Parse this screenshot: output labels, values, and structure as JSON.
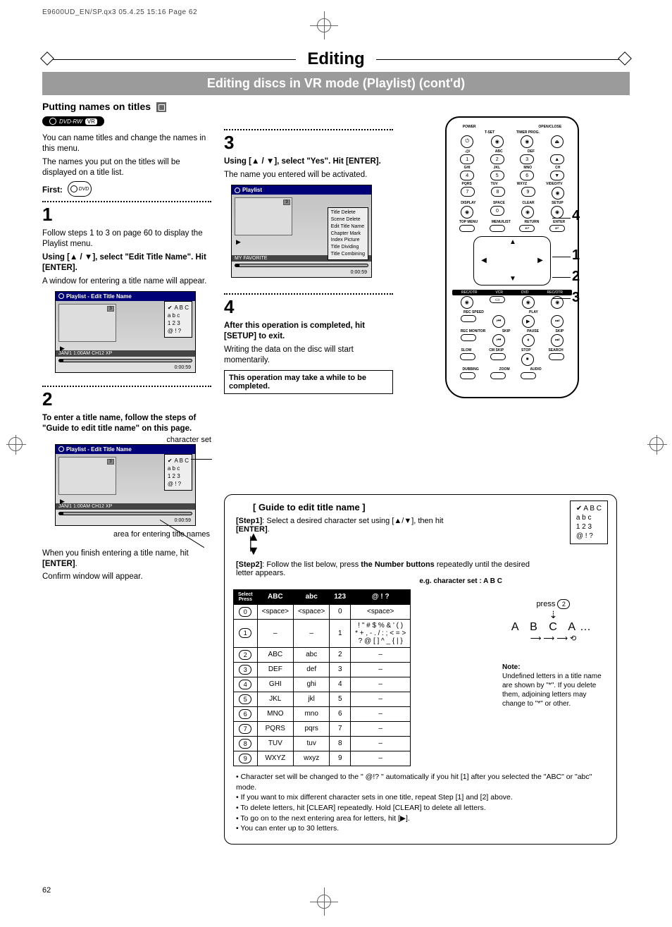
{
  "pageinfo": "E9600UD_EN/SP.qx3  05.4.25 15:16  Page 62",
  "title": "Editing",
  "subtitle": "Editing discs in VR mode (Playlist) (cont'd)",
  "section": "Putting names on titles",
  "dvdrw_badge": {
    "text": "DVD-RW",
    "corner": "VR"
  },
  "intro_p1": "You can name titles and change the names in this menu.",
  "intro_p2": "The names you put on the titles will be displayed on a title list.",
  "first_label": "First:",
  "first_icon_text": "DVD",
  "step1_num": "1",
  "step1_p1": "Follow steps 1 to 3 on page 60 to display the Playlist menu.",
  "step1_bold": "Using [▲ / ▼], select \"Edit Title Name\". Hit [ENTER].",
  "step1_p2": "A window for entering a title name will appear.",
  "osd1": {
    "header": "Playlist - Edit Title Name",
    "thumb_badge": "3",
    "charset": [
      "A B C",
      "a b c",
      "1 2 3",
      "@ ! ?"
    ],
    "footer_left": "JAN/1 1:00AM CH12 XP",
    "footer_right": "0:00:59"
  },
  "step2_num": "2",
  "step2_bold": "To enter a title name, follow the steps of \"Guide to edit title name\" on this page.",
  "step2_lbl_charset": "character set",
  "step2_lbl_area": "area for entering title names",
  "step2_p1": "When you finish entering a title name, hit ",
  "step2_enter": "[ENTER]",
  "step2_p2": "Confirm window will appear.",
  "step3_num": "3",
  "step3_bold": "Using [▲ / ▼], select \"Yes\". Hit [ENTER].",
  "step3_p1": "The name you entered will be activated.",
  "osd3": {
    "header": "Playlist",
    "thumb_badge": "3",
    "menu": [
      "Title Delete",
      "Scene Delete",
      "Edit Title Name",
      "Chapter Mark",
      "Index Picture",
      "Title Dividing",
      "Title Combining"
    ],
    "footer_left": "MY FAVORITE",
    "footer_right": "0:00:59"
  },
  "step4_num": "4",
  "step4_bold": "After this operation is completed, hit [SETUP] to exit.",
  "step4_p1": "Writing the data on the disc will start momentarily.",
  "step4_note": "This operation may take a while to be completed.",
  "remote_labels": {
    "r1": [
      "POWER",
      "",
      "",
      "OPEN/CLOSE"
    ],
    "r2": [
      "",
      "T-SET",
      "TIMER PROG.",
      ""
    ],
    "r3": [
      ".@/",
      "ABC",
      "DEF",
      ""
    ],
    "r4": [
      "GHI",
      "JKL",
      "MNO",
      "CH"
    ],
    "r5": [
      "PQRS",
      "TUV",
      "WXYZ",
      "VIDEO/TV"
    ],
    "r6": [
      "DISPLAY",
      "SPACE",
      "CLEAR",
      "SETUP"
    ],
    "r7": [
      "TOP MENU",
      "MENU/LIST",
      "RETURN",
      "ENTER"
    ],
    "bar1": [
      "REC/OTR",
      "VCR",
      "DVD",
      "REC/OTR"
    ],
    "r8": [
      "REC SPEED",
      "",
      "PLAY",
      ""
    ],
    "r9": [
      "REC MONITOR",
      "SKIP",
      "PAUSE",
      "SKIP"
    ],
    "r10": [
      "SLOW",
      "CM SKIP",
      "STOP",
      "SEARCH"
    ],
    "r11": [
      "DUBBING",
      "ZOOM",
      "AUDIO",
      ""
    ]
  },
  "remote_numbers": [
    "0",
    "1",
    "2",
    "3",
    "4",
    "5",
    "6",
    "7",
    "8",
    "9"
  ],
  "side_numbers": [
    "4",
    "1",
    "2",
    "3"
  ],
  "guide": {
    "title": "[ Guide to edit title name ]",
    "step1_label": "[Step1]",
    "step1_text": ": Select a desired character set using [▲/▼], then hit ",
    "step1_enter": "[ENTER]",
    "step2_label": "[Step2]",
    "step2_text": ": Follow the list below, press ",
    "step2_bold": "the Number buttons",
    "step2_text2": " repeatedly until the desired letter appears.",
    "example_caption": "e.g. character set : A B C",
    "example_press": "press",
    "example_key": "2",
    "example_letters": "A B C A…",
    "charbox": [
      "A B C",
      "a b c",
      "1 2 3",
      "@ ! ?"
    ],
    "table": {
      "diag_top": "Select",
      "diag_bot": "Press",
      "headers": [
        "ABC",
        "abc",
        "123",
        "@ ! ?"
      ],
      "rows": [
        {
          "key": "0",
          "cells": [
            "<space>",
            "<space>",
            "0",
            "<space>"
          ]
        },
        {
          "key": "1",
          "cells": [
            "–",
            "–",
            "1",
            "! \" # $ % & ' ( )\n* + , - . / : ; < = >\n? @ [ ] ^ _ { | }"
          ]
        },
        {
          "key": "2",
          "cells": [
            "ABC",
            "abc",
            "2",
            "–"
          ]
        },
        {
          "key": "3",
          "cells": [
            "DEF",
            "def",
            "3",
            "–"
          ]
        },
        {
          "key": "4",
          "cells": [
            "GHI",
            "ghi",
            "4",
            "–"
          ]
        },
        {
          "key": "5",
          "cells": [
            "JKL",
            "jkl",
            "5",
            "–"
          ]
        },
        {
          "key": "6",
          "cells": [
            "MNO",
            "mno",
            "6",
            "–"
          ]
        },
        {
          "key": "7",
          "cells": [
            "PQRS",
            "pqrs",
            "7",
            "–"
          ]
        },
        {
          "key": "8",
          "cells": [
            "TUV",
            "tuv",
            "8",
            "–"
          ]
        },
        {
          "key": "9",
          "cells": [
            "WXYZ",
            "wxyz",
            "9",
            "–"
          ]
        }
      ]
    },
    "note_title": "Note:",
    "note_text": "Undefined letters in a title name are shown by \"*\".  If you delete them, adjoining letters may change to \"*\" or other.",
    "bullets": [
      "Character set will be changed to the \" @!? \" automatically if you hit [1] after you selected the \"ABC\" or \"abc\" mode.",
      "If you want to mix different character sets in one title, repeat Step [1] and [2] above.",
      "To delete letters, hit [CLEAR] repeatedly. Hold [CLEAR] to delete all letters.",
      "To go on to the next entering area for letters, hit [▶].",
      "You can enter up to 30 letters."
    ]
  },
  "pagenum": "62"
}
